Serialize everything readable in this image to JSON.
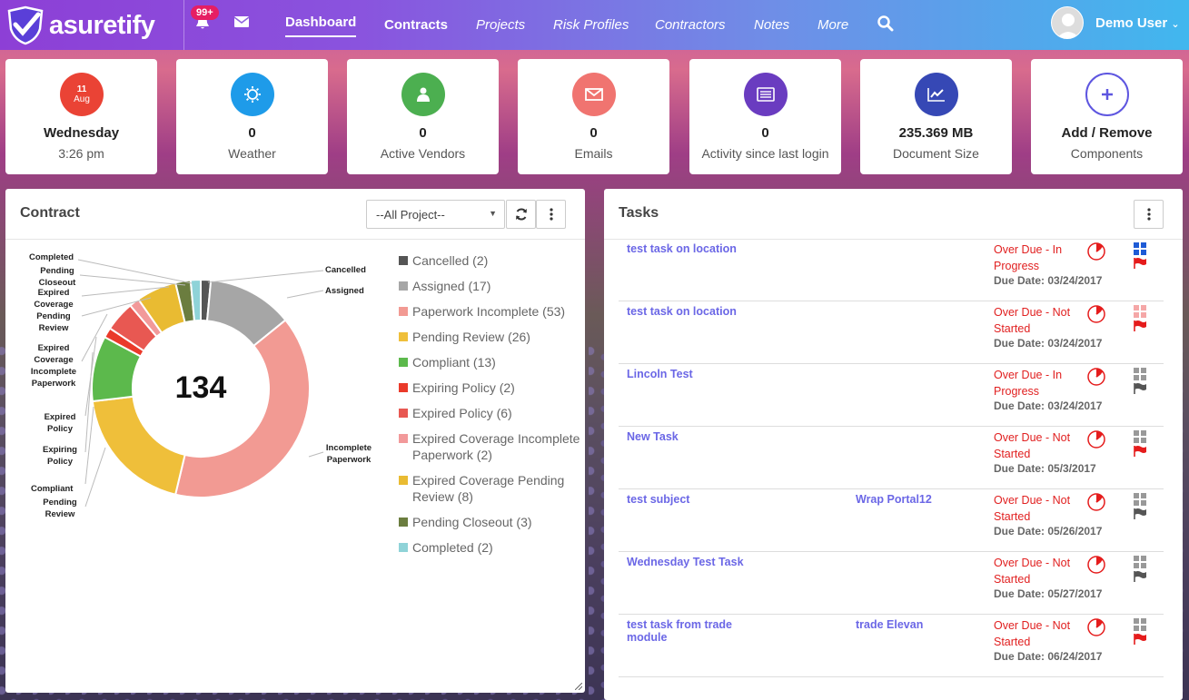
{
  "app": {
    "name": "asuretify",
    "badge": "99+"
  },
  "nav": {
    "items": [
      "Dashboard",
      "Contracts",
      "Projects",
      "Risk Profiles",
      "Contractors",
      "Notes",
      "More"
    ],
    "user": "Demo User"
  },
  "widgets": [
    {
      "top": "11",
      "sub": "Aug",
      "value": "Wednesday",
      "label": "3:26 pm",
      "color": "#ea4335",
      "icon": "calendar-icon"
    },
    {
      "value": "0",
      "label": "Weather",
      "color": "#1e9be9",
      "icon": "sun-icon"
    },
    {
      "value": "0",
      "label": "Active Vendors",
      "color": "#4caf50",
      "icon": "user-icon"
    },
    {
      "value": "0",
      "label": "Emails",
      "color": "#f07470",
      "icon": "envelope-icon"
    },
    {
      "value": "0",
      "label": "Activity since last login",
      "color": "#6a3cc0",
      "icon": "activity-list-icon"
    },
    {
      "value": "235.369 MB",
      "label": "Document Size",
      "color": "#3648b5",
      "icon": "chart-icon"
    },
    {
      "value": "Add / Remove",
      "label": "Components",
      "color": "#ffffff",
      "icon": "plus-icon"
    }
  ],
  "contract": {
    "title": "Contract",
    "select": "--All Project--",
    "total": "134"
  },
  "chart_data": {
    "type": "pie",
    "categories": [
      "Cancelled",
      "Assigned",
      "Paperwork Incomplete",
      "Pending Review",
      "Compliant",
      "Expiring Policy",
      "Expired Policy",
      "Expired Coverage Incomplete Paperwork",
      "Expired Coverage Pending Review",
      "Pending Closeout",
      "Completed"
    ],
    "values": [
      2,
      17,
      53,
      26,
      13,
      2,
      6,
      2,
      8,
      3,
      2
    ],
    "colors": [
      "#555555",
      "#a6a6a6",
      "#f29a93",
      "#efbf3a",
      "#5cb94c",
      "#ea3a2a",
      "#e85852",
      "#f2999a",
      "#e9bb32",
      "#6b7d3f",
      "#8fd3d8"
    ],
    "legend": [
      "Cancelled (2)",
      "Assigned (17)",
      "Paperwork Incomplete (53)",
      "Pending Review (26)",
      "Compliant (13)",
      "Expiring Policy (2)",
      "Expired Policy (6)",
      "Expired Coverage Incomplete Paperwork (2)",
      "Expired Coverage Pending Review (8)",
      "Pending Closeout (3)",
      "Completed (2)"
    ],
    "slice_labels": [
      "Completed",
      "Pending Closeout",
      "Expired Coverage Pending Review",
      "Expired Coverage Incomplete Paperwork",
      "Expired Policy",
      "Expiring Policy",
      "Compliant",
      "Pending Review",
      "Cancelled",
      "Assigned",
      "Incomplete Paperwork"
    ]
  },
  "tasks": {
    "title": "Tasks",
    "items": [
      {
        "name": "test task on location",
        "project": "",
        "status": "Over Due - In Progress",
        "due": "Due Date: 03/24/2017",
        "grid": "blue",
        "flag": "red"
      },
      {
        "name": "test task on location",
        "project": "",
        "status": "Over Due - Not Started",
        "due": "Due Date: 03/24/2017",
        "grid": "pink",
        "flag": "red"
      },
      {
        "name": "Lincoln Test",
        "project": "",
        "status": "Over Due - In Progress",
        "due": "Due Date: 03/24/2017",
        "grid": "gray",
        "flag": "gray"
      },
      {
        "name": "New Task",
        "project": "",
        "status": "Over Due - Not Started",
        "due": "Due Date: 05/3/2017",
        "grid": "gray",
        "flag": "red"
      },
      {
        "name": "test subject",
        "project": "Wrap Portal12",
        "status": "Over Due - Not Started",
        "due": "Due Date: 05/26/2017",
        "grid": "gray",
        "flag": "gray"
      },
      {
        "name": "Wednesday Test Task",
        "project": "",
        "status": "Over Due - Not Started",
        "due": "Due Date: 05/27/2017",
        "grid": "gray",
        "flag": "gray"
      },
      {
        "name": "test task from trade module",
        "project": "trade Elevan",
        "status": "Over Due - Not Started",
        "due": "Due Date: 06/24/2017",
        "grid": "gray",
        "flag": "red"
      }
    ]
  }
}
